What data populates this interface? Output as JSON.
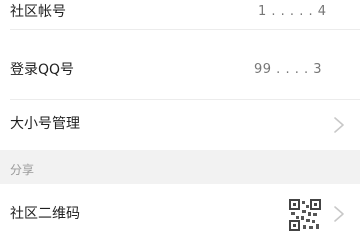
{
  "rows": {
    "community_account": {
      "label": "社区帐号",
      "value": "1 . . . . . 4"
    },
    "login_qq": {
      "label": "登录QQ号",
      "value": "99 . . . . 3"
    },
    "account_manage": {
      "label": "大小号管理",
      "chevron_icon": "chevron-right-icon"
    }
  },
  "share_section": {
    "title": "分享",
    "qr_row": {
      "label": "社区二维码",
      "qr_icon": "qr-code-icon",
      "chevron_icon": "chevron-right-icon"
    }
  },
  "colors": {
    "section_background": "#f2f2f2",
    "divider": "#ececec",
    "chevron": "#c8c8c8"
  }
}
